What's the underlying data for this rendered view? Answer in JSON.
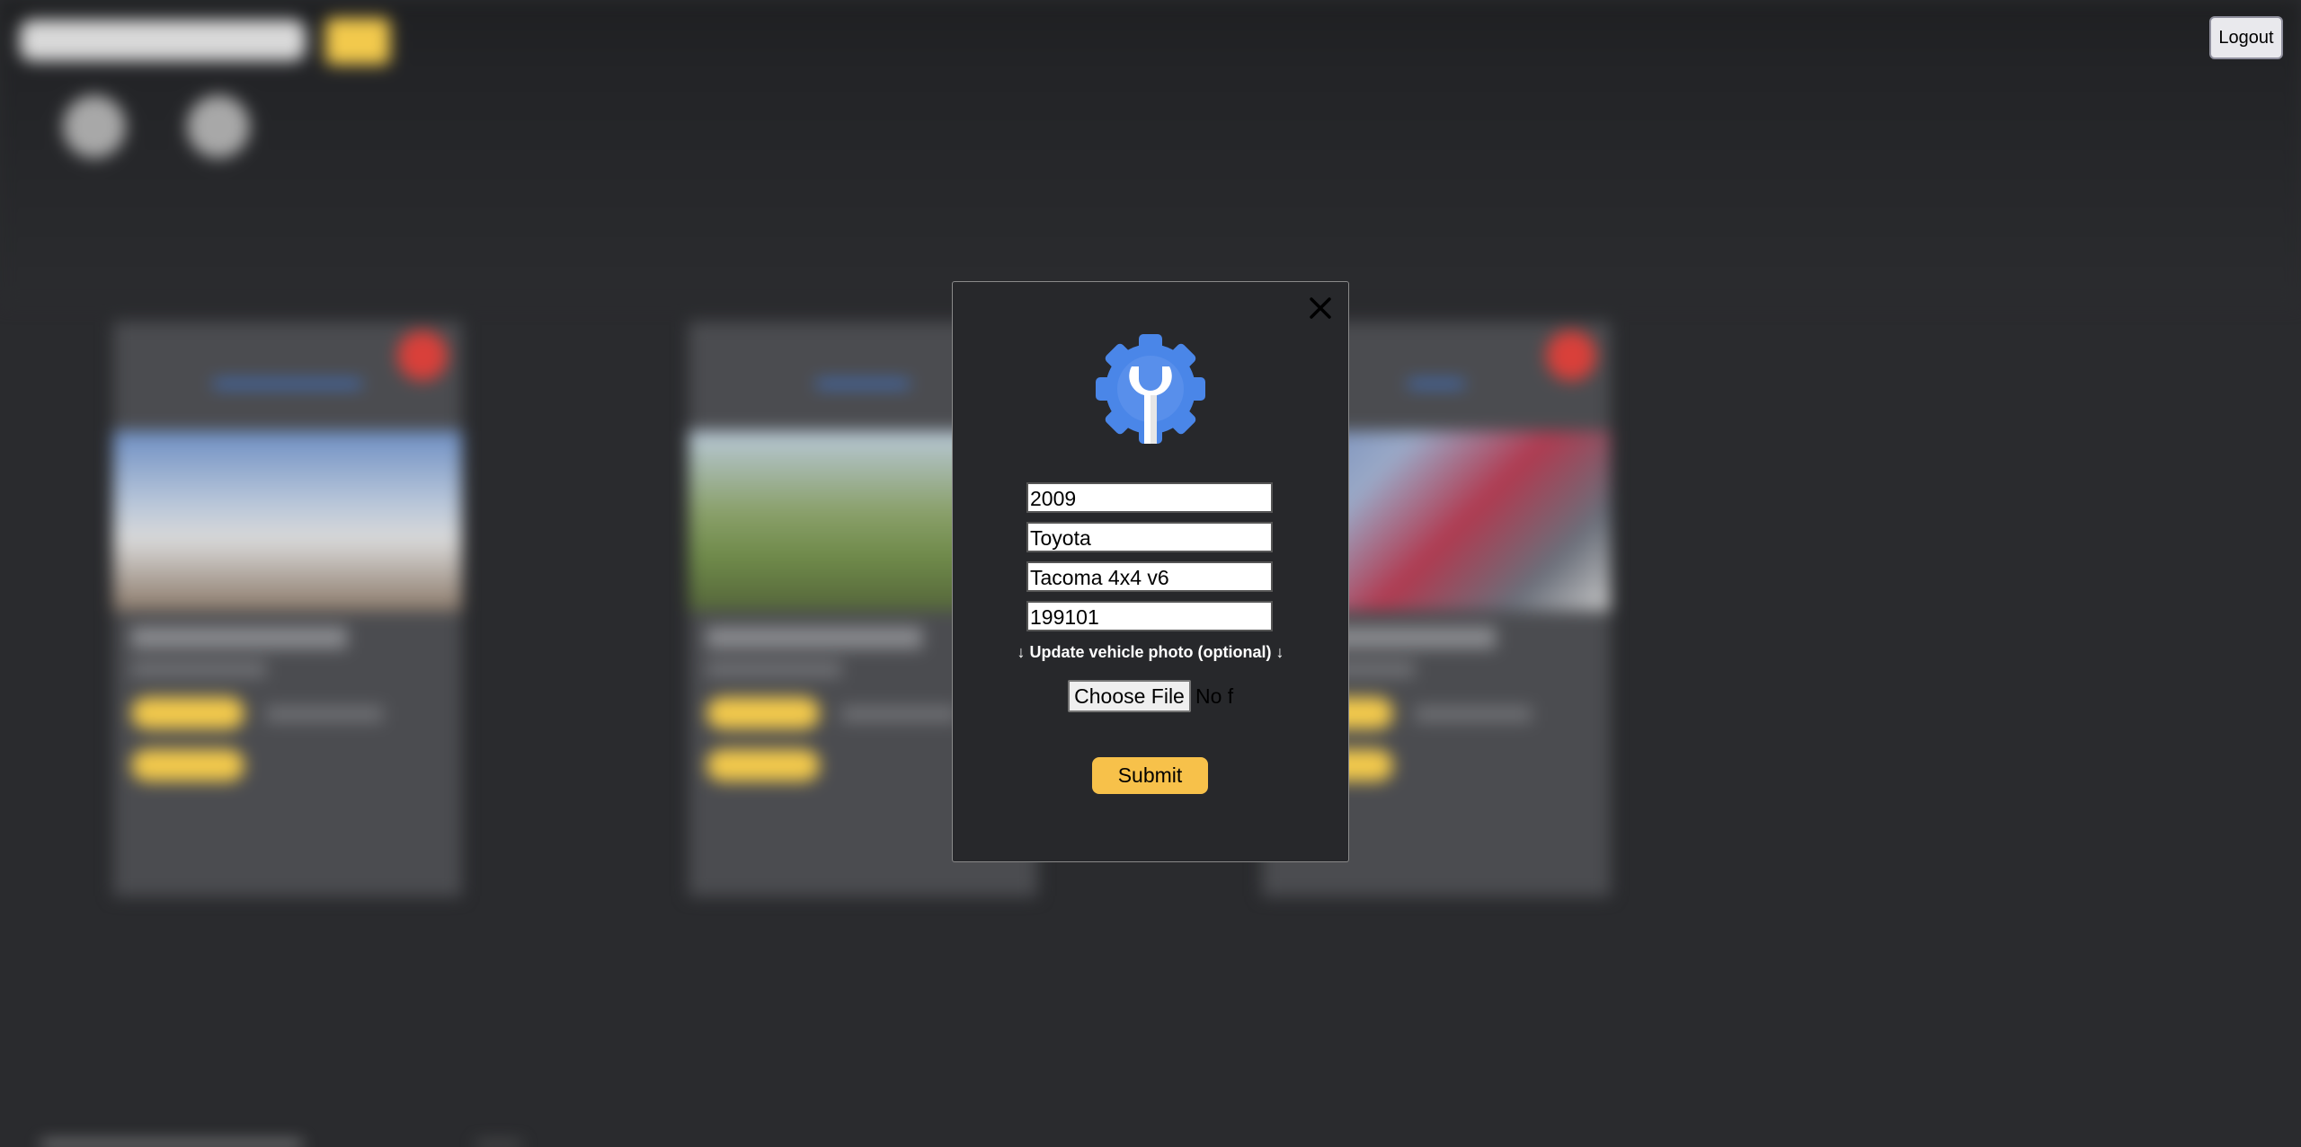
{
  "header": {
    "logout_label": "Logout"
  },
  "modal": {
    "close_icon": "close-icon",
    "logo_icon": "gear-wrench-icon",
    "fields": {
      "year": "2009",
      "make": "Toyota",
      "model": "Tacoma 4x4 v6",
      "mileage": "199101"
    },
    "photo_label": "↓ Update vehicle photo (optional) ↓",
    "choose_file_label": "Choose File",
    "file_status": "No f",
    "submit_label": "Submit"
  },
  "colors": {
    "accent_yellow": "#f7c14a",
    "logo_blue": "#4a86e8",
    "modal_bg": "#27282b",
    "page_bg": "#2a2b2e"
  }
}
